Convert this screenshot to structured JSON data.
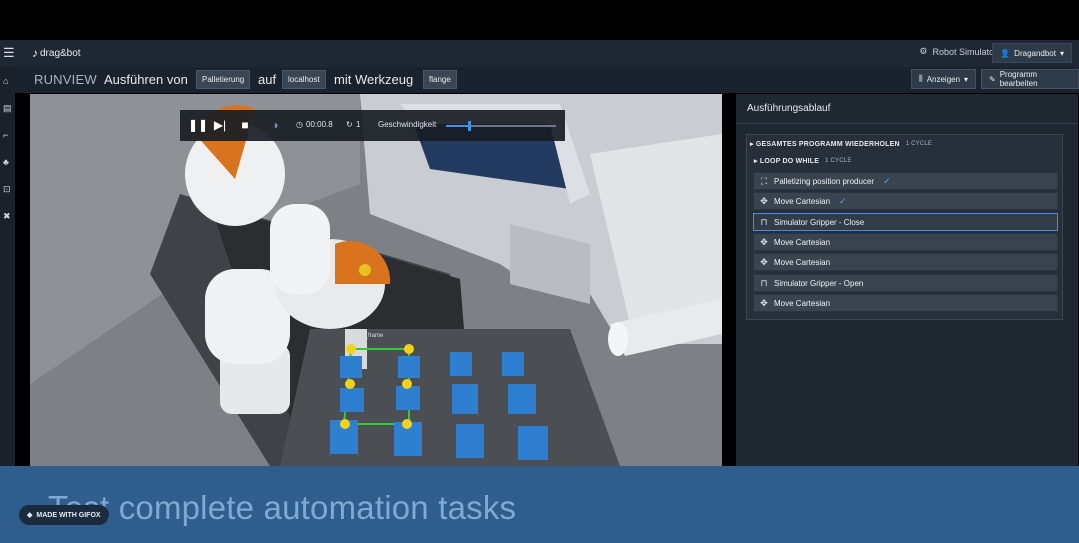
{
  "app": {
    "logo_text": "drag&bot",
    "robot_simulator": "Robot Simulator",
    "user": "Dragandbot"
  },
  "breadcrumb": {
    "mode": "RUNVIEW",
    "run_label": "Ausführen von",
    "program": "Palletierung",
    "on_label": "auf",
    "host": "localhost",
    "tool_label": "mit Werkzeug",
    "tool": "flange"
  },
  "toolbar": {
    "view_label": "Anzeigen",
    "edit_label": "Programm bearbeiten"
  },
  "player": {
    "time": "00:00.8",
    "loop_count": "1",
    "speed_label": "Geschwindigkeit",
    "speed_fraction": 0.2
  },
  "panel": {
    "title": "Ausführungsablauf",
    "repeat_group": "GESAMTES PROGRAMM WIEDERHOLEN",
    "repeat_cycles": "1 CYCLE",
    "loop_group": "LOOP DO WHILE",
    "loop_cycles": "1 CYCLE",
    "steps": [
      {
        "label": "Palletizing position producer",
        "icon": "pallet-icon",
        "done": true
      },
      {
        "label": "Move Cartesian",
        "icon": "move-icon",
        "done": true
      },
      {
        "label": "Simulator Gripper - Close",
        "icon": "gripper-icon",
        "done": false,
        "active": true
      },
      {
        "label": "Move Cartesian",
        "icon": "move-icon",
        "done": false
      },
      {
        "label": "Move Cartesian",
        "icon": "move-icon",
        "done": false
      },
      {
        "label": "Simulator Gripper - Open",
        "icon": "gripper-icon",
        "done": false
      },
      {
        "label": "Move Cartesian",
        "icon": "move-icon",
        "done": false
      }
    ]
  },
  "viewport": {
    "tool_frame_label": "tool_frame"
  },
  "overlay": {
    "caption": "Test complete automation tasks",
    "badge": "MADE WITH GIFOX"
  }
}
